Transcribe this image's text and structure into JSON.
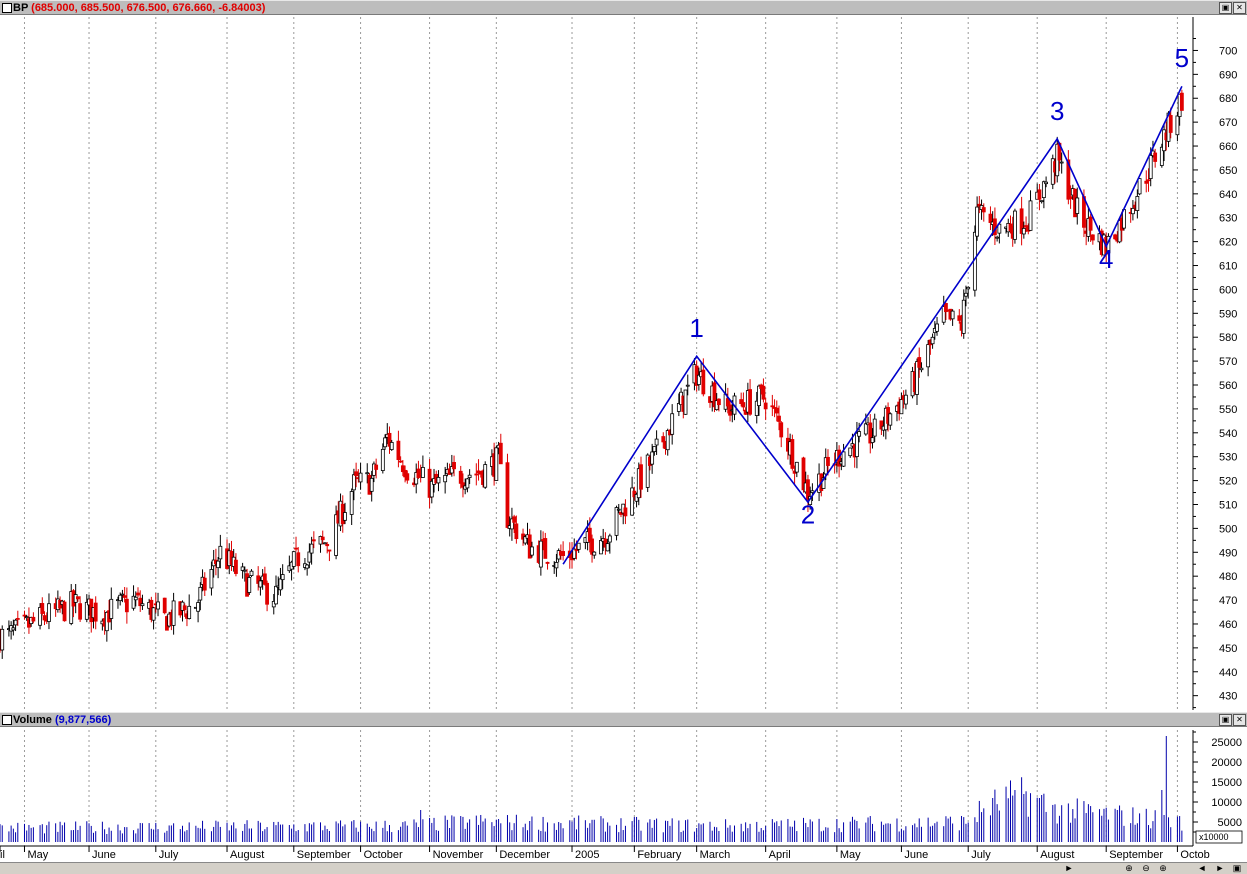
{
  "price_panel": {
    "symbol": "BP",
    "quote": "(685.000, 685.500, 676.500, 676.660, -6.84003)"
  },
  "volume_panel": {
    "label": "Volume",
    "value": "(9,877,566)",
    "scale_label": "x10000"
  },
  "icons": [
    "restore-icon",
    "close-icon",
    "scroll-left-icon",
    "scroll-right-icon",
    "zoom-in-icon",
    "zoom-out-icon"
  ],
  "colors": {
    "up": "#000000",
    "down": "#e00000",
    "wave_line": "#0000cc",
    "quote_text": "#e00000",
    "volume_value": "#0000cc",
    "volume_bars": "#0000aa"
  },
  "chart_data": [
    {
      "type": "candlestick",
      "title": "BP",
      "y_ticks": [
        430,
        440,
        450,
        460,
        470,
        480,
        490,
        500,
        510,
        520,
        530,
        540,
        550,
        560,
        570,
        580,
        590,
        600,
        610,
        620,
        630,
        640,
        650,
        660,
        670,
        680,
        690,
        700
      ],
      "ylim": [
        424,
        714
      ],
      "x_labels": [
        "il",
        "May",
        "June",
        "July",
        "August",
        "September",
        "October",
        "November",
        "December",
        "2005",
        "February",
        "March",
        "April",
        "May",
        "June",
        "July",
        "August",
        "September",
        "Octob"
      ],
      "grid": "vertical dotted lines at month starts",
      "trend_path": [
        {
          "x": "2004-12-31",
          "y": 485
        },
        {
          "x": "2005-03-01",
          "y": 572
        },
        {
          "x": "2005-04-20",
          "y": 511
        },
        {
          "x": "2005-08-10",
          "y": 663
        },
        {
          "x": "2005-09-01",
          "y": 618
        },
        {
          "x": "2005-10-05",
          "y": 685
        }
      ],
      "wave_labels": [
        {
          "text": "1",
          "x": "2005-03-01",
          "y": 580
        },
        {
          "text": "2",
          "x": "2005-04-20",
          "y": 502
        },
        {
          "text": "3",
          "x": "2005-08-10",
          "y": 671
        },
        {
          "text": "4",
          "x": "2005-09-01",
          "y": 609
        },
        {
          "text": "5",
          "x": "2005-10-05",
          "y": 693
        }
      ],
      "close_path": [
        {
          "x": "2004-04-26",
          "y": 455
        },
        {
          "x": "2004-05-10",
          "y": 462
        },
        {
          "x": "2004-05-25",
          "y": 468
        },
        {
          "x": "2004-06-07",
          "y": 464
        },
        {
          "x": "2004-06-21",
          "y": 470
        },
        {
          "x": "2004-07-05",
          "y": 462
        },
        {
          "x": "2004-07-19",
          "y": 468
        },
        {
          "x": "2004-07-30",
          "y": 490
        },
        {
          "x": "2004-08-10",
          "y": 478
        },
        {
          "x": "2004-08-24",
          "y": 472
        },
        {
          "x": "2004-09-03",
          "y": 488
        },
        {
          "x": "2004-09-17",
          "y": 495
        },
        {
          "x": "2004-09-28",
          "y": 518
        },
        {
          "x": "2004-10-06",
          "y": 520
        },
        {
          "x": "2004-10-13",
          "y": 538
        },
        {
          "x": "2004-10-22",
          "y": 525
        },
        {
          "x": "2004-11-02",
          "y": 517
        },
        {
          "x": "2004-11-12",
          "y": 522
        },
        {
          "x": "2004-11-25",
          "y": 524
        },
        {
          "x": "2004-12-02",
          "y": 529
        },
        {
          "x": "2004-12-06",
          "y": 505
        },
        {
          "x": "2004-12-16",
          "y": 492
        },
        {
          "x": "2004-12-31",
          "y": 488
        },
        {
          "x": "2005-01-20",
          "y": 498
        },
        {
          "x": "2005-02-10",
          "y": 530
        },
        {
          "x": "2005-03-01",
          "y": 565
        },
        {
          "x": "2005-03-15",
          "y": 550
        },
        {
          "x": "2005-04-01",
          "y": 555
        },
        {
          "x": "2005-04-10",
          "y": 538
        },
        {
          "x": "2005-04-20",
          "y": 515
        },
        {
          "x": "2005-05-05",
          "y": 532
        },
        {
          "x": "2005-05-20",
          "y": 540
        },
        {
          "x": "2005-06-05",
          "y": 558
        },
        {
          "x": "2005-06-20",
          "y": 588
        },
        {
          "x": "2005-06-28",
          "y": 585
        },
        {
          "x": "2005-07-05",
          "y": 632
        },
        {
          "x": "2005-07-15",
          "y": 625
        },
        {
          "x": "2005-07-28",
          "y": 630
        },
        {
          "x": "2005-08-10",
          "y": 655
        },
        {
          "x": "2005-08-20",
          "y": 630
        },
        {
          "x": "2005-09-01",
          "y": 618
        },
        {
          "x": "2005-09-10",
          "y": 632
        },
        {
          "x": "2005-09-20",
          "y": 650
        },
        {
          "x": "2005-10-05",
          "y": 680
        }
      ],
      "x_range": [
        "2004-04-22",
        "2005-10-10"
      ]
    },
    {
      "type": "bar",
      "title": "Volume",
      "unit": "x10000",
      "y_ticks": [
        5000,
        10000,
        15000,
        20000,
        25000
      ],
      "ylim": [
        0,
        28000
      ],
      "typical_volume": 4000,
      "volume_path": [
        {
          "x": "2004-04-22",
          "y": 3500
        },
        {
          "x": "2004-10-20",
          "y": 4000
        },
        {
          "x": "2004-11-20",
          "y": 5000
        },
        {
          "x": "2005-03-15",
          "y": 4000
        },
        {
          "x": "2005-06-30",
          "y": 5000
        },
        {
          "x": "2005-07-10",
          "y": 9000
        },
        {
          "x": "2005-07-25",
          "y": 12000
        },
        {
          "x": "2005-08-10",
          "y": 8000
        },
        {
          "x": "2005-09-20",
          "y": 6000
        },
        {
          "x": "2005-10-05",
          "y": 5000
        }
      ],
      "spikes": [
        {
          "x": "2004-10-28",
          "y": 8000
        },
        {
          "x": "2005-07-12",
          "y": 11000
        },
        {
          "x": "2005-07-22",
          "y": 13000
        },
        {
          "x": "2005-07-26",
          "y": 12000
        },
        {
          "x": "2005-08-02",
          "y": 11000
        },
        {
          "x": "2005-09-26",
          "y": 13000
        },
        {
          "x": "2005-09-28",
          "y": 26500
        }
      ]
    }
  ]
}
